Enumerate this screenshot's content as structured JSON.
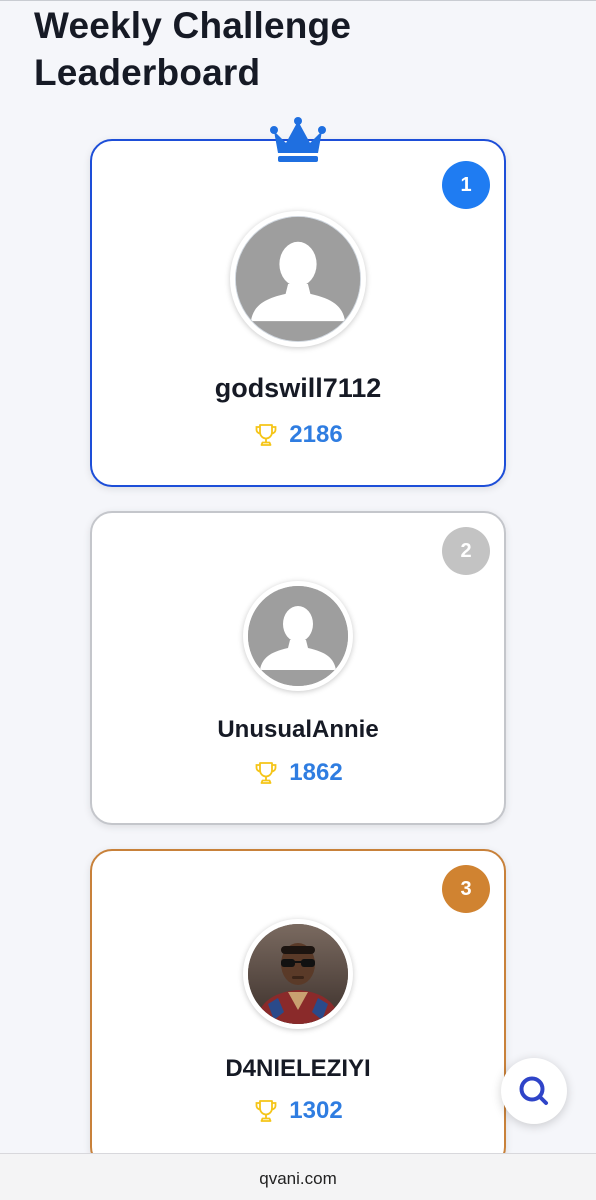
{
  "page": {
    "title": "Weekly Challenge Leaderboard"
  },
  "leaderboard": [
    {
      "rank": "1",
      "username": "godswill7112",
      "score": "2186",
      "avatar": "default-avatar",
      "color": "#1f7cf2"
    },
    {
      "rank": "2",
      "username": "UnusualAnnie",
      "score": "1862",
      "avatar": "default-avatar",
      "color": "#c3c3c3"
    },
    {
      "rank": "3",
      "username": "D4NIELEZIYI",
      "score": "1302",
      "avatar": "profile-photo",
      "color": "#d08331"
    }
  ],
  "icons": {
    "crown": "crown-icon",
    "trophy": "trophy-icon",
    "search": "search-icon"
  },
  "colors": {
    "accent": "#1d4ed8",
    "score": "#2f7de1",
    "trophy": "#f5c518",
    "gold_border": "#1d4ed8",
    "silver_border": "#c4c6cb",
    "bronze_border": "#c8813a"
  },
  "browser": {
    "url": "qvani.com"
  }
}
